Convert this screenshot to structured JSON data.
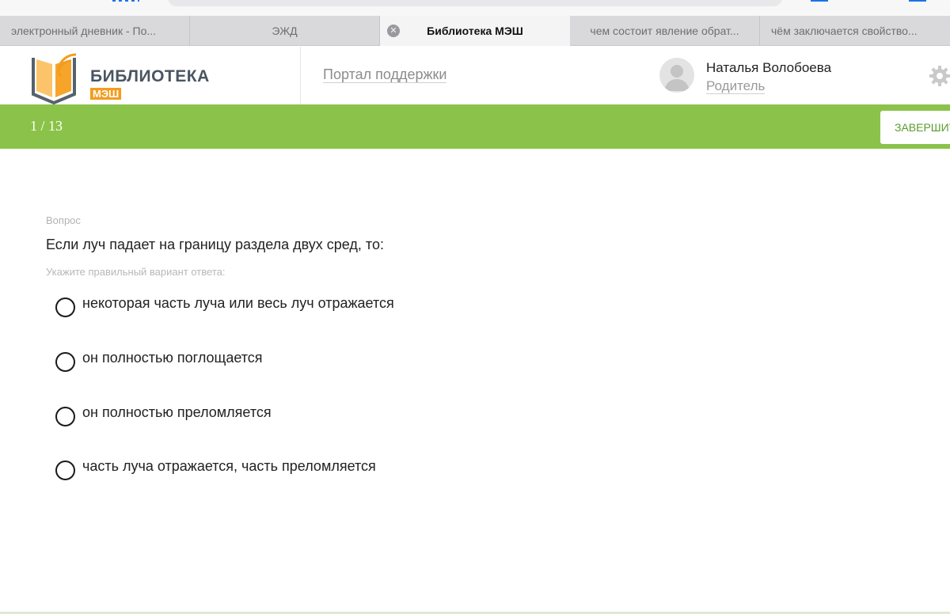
{
  "tabs": [
    {
      "label": "электронный дневник - По..."
    },
    {
      "label": "ЭЖД"
    },
    {
      "label": "Библиотека МЭШ",
      "active": true
    },
    {
      "label": "чем состоит явление обрат..."
    },
    {
      "label": "чём заключается свойство..."
    }
  ],
  "header": {
    "logo_main": "БИБЛИОТЕКА",
    "logo_sub": "МЭШ",
    "support_link": "Портал поддержки",
    "user_name": "Наталья Волобоева",
    "user_role": "Родитель"
  },
  "progress": {
    "counter": "1 / 13",
    "finish_label": "ЗАВЕРШИТЬ"
  },
  "question": {
    "label": "Вопрос",
    "text": "Если луч падает на границу раздела двух сред, то:",
    "hint": "Укажите правильный вариант ответа:",
    "options": [
      "некоторая часть луча или весь луч отражается",
      "он полностью поглощается",
      "он полностью преломляется",
      "часть луча отражается, часть преломляется"
    ]
  },
  "colors": {
    "green_bar": "#8bc34a",
    "logo_orange": "#f39c1f",
    "logo_gray": "#4a5560"
  },
  "icons": [
    "tab-close-icon",
    "book-logo-icon",
    "avatar-icon",
    "gear-icon"
  ]
}
